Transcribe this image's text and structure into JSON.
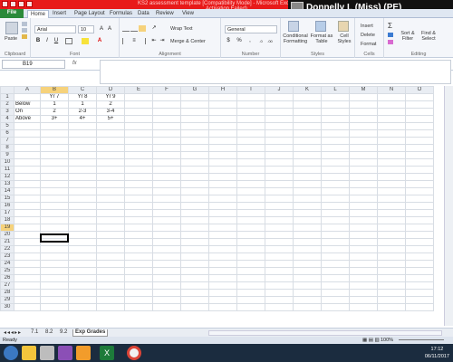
{
  "window": {
    "title": "KS2 assessment template  [Compatibility Mode]  -  Microsoft Excel (Product Activation Failed)",
    "user": "Donnelly L (Miss) (PE)"
  },
  "tabs": [
    "Home",
    "Insert",
    "Page Layout",
    "Formulas",
    "Data",
    "Review",
    "View"
  ],
  "file_tab": "File",
  "ribbon": {
    "clipboard": {
      "label": "Clipboard",
      "paste": "Paste"
    },
    "font": {
      "label": "Font",
      "name": "Arial",
      "size": "10",
      "bold": "B",
      "italic": "I",
      "underline": "U"
    },
    "alignment": {
      "label": "Alignment",
      "wrap": "Wrap Text",
      "merge": "Merge & Center"
    },
    "number": {
      "label": "Number",
      "format": "General",
      "percent": "%",
      "comma": ","
    },
    "styles": {
      "label": "Styles",
      "conditional": "Conditional Formatting",
      "format_table": "Format as Table",
      "cell_styles": "Cell Styles"
    },
    "cells": {
      "label": "Cells",
      "insert": "Insert",
      "delete": "Delete",
      "format": "Format"
    },
    "editing": {
      "label": "Editing",
      "sum": "Σ",
      "sort": "Sort & Filter",
      "find": "Find & Select"
    }
  },
  "namebox": "B19",
  "fx": "fx",
  "columns": [
    "A",
    "B",
    "C",
    "D",
    "E",
    "F",
    "G",
    "H",
    "I",
    "J",
    "K",
    "L",
    "M",
    "N",
    "O"
  ],
  "rows": [
    [
      "",
      "Yr 7",
      "Yr 8",
      "Yr 9",
      "",
      "",
      "",
      "",
      "",
      "",
      "",
      "",
      "",
      "",
      ""
    ],
    [
      "Below",
      "1",
      "1",
      "2",
      "",
      "",
      "",
      "",
      "",
      "",
      "",
      "",
      "",
      "",
      ""
    ],
    [
      "On",
      "2",
      "2-3",
      "3-4",
      "",
      "",
      "",
      "",
      "",
      "",
      "",
      "",
      "",
      "",
      ""
    ],
    [
      "Above",
      "3+",
      "4+",
      "5+",
      "",
      "",
      "",
      "",
      "",
      "",
      "",
      "",
      "",
      "",
      ""
    ]
  ],
  "total_rows": 30,
  "selected_row": 19,
  "selected_col": "B",
  "sheets": [
    "7.1",
    "8.2",
    "9.2",
    "Exp Grades"
  ],
  "active_sheet": "Exp Grades",
  "status": {
    "ready": "Ready",
    "zoom": "100%"
  },
  "clock": {
    "time": "17:12",
    "date": "06/11/2017"
  }
}
